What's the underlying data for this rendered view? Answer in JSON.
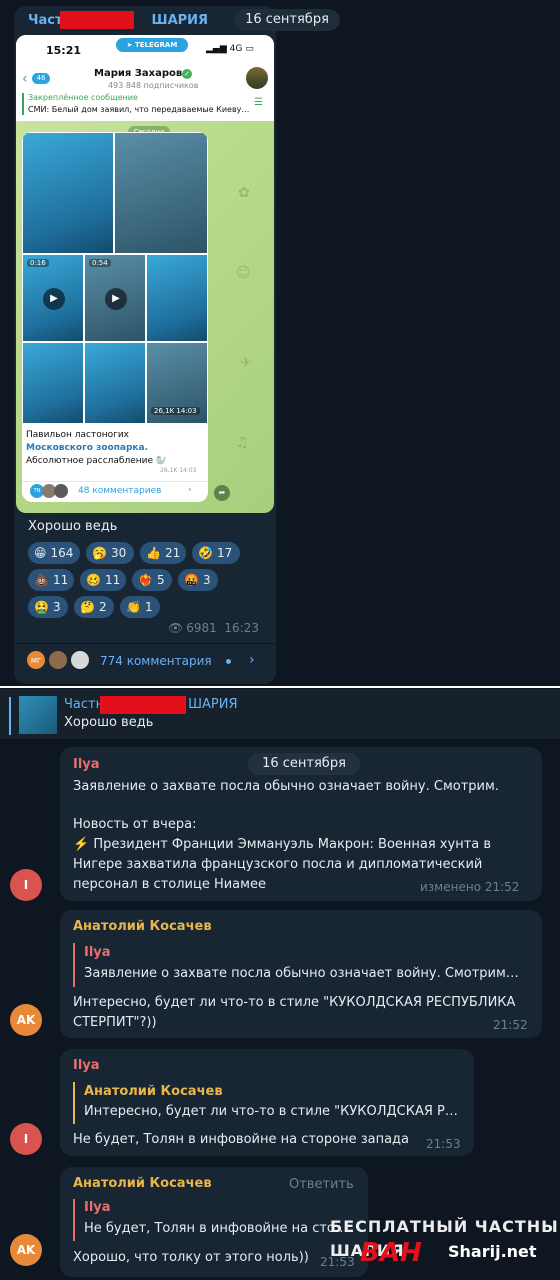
{
  "post": {
    "channel_name_left": "Частн",
    "channel_name_right": "ШАРИЯ",
    "date": "16 сентября",
    "screenshot": {
      "time": "15:21",
      "telegram_label": "TELEGRAM",
      "signal": "4G",
      "back_badge": "46",
      "channel_name": "Мария Захарова",
      "subscribers": "493 848 подписчиков",
      "pinned_title": "Закреплённое сообщение",
      "pinned_text": "СМИ: Белый дом заявил, что передаваемые Киеву…",
      "today": "Сегодня",
      "video1_duration": "0:16",
      "video2_duration": "0:54",
      "photo_views": "26,1K 14:03",
      "caption_line1": "Павильон ластоногих",
      "caption_line2": "Московского зоопарка.",
      "caption_line3": "Абсолютное расслабление 🦭",
      "caption_meta": "26,1K 14:03",
      "comment_avatars": [
        "TN",
        "",
        ""
      ],
      "comments_label": "48 комментариев"
    },
    "text": "Хорошо ведь",
    "reactions": [
      {
        "emoji": "😁",
        "count": "164"
      },
      {
        "emoji": "🥱",
        "count": "30"
      },
      {
        "emoji": "👍",
        "count": "21"
      },
      {
        "emoji": "🤣",
        "count": "17"
      },
      {
        "emoji": "💩",
        "count": "11"
      },
      {
        "emoji": "🥴",
        "count": "11"
      },
      {
        "emoji": "❤‍🔥",
        "count": "5"
      },
      {
        "emoji": "🤬",
        "count": "3"
      },
      {
        "emoji": "🤮",
        "count": "3"
      },
      {
        "emoji": "🤔",
        "count": "2"
      },
      {
        "emoji": "👏",
        "count": "1"
      }
    ],
    "views": "6981",
    "time": "16:23",
    "comment_avatars": [
      "МГ",
      "",
      ""
    ],
    "comments_label": "774 комментария"
  },
  "chat": {
    "reply_header": {
      "title_left": "Частн",
      "title_right": "ШАРИЯ",
      "text": "Хорошо ведь"
    },
    "date_chip": "16 сентября",
    "messages": [
      {
        "author": "Ilya",
        "avatar": "I",
        "lines": [
          "Заявление о захвате посла обычно означает войну. Смотрим.",
          "",
          "Новость от вчера:",
          "⚡️ Президент Франции Эммануэль Макрон: Военная хунта в",
          "Нигере захватила французского посла и дипломатический",
          "персонал в столице Ниамее"
        ],
        "time": "изменено 21:52"
      },
      {
        "author": "Анатолий Косачев",
        "avatar": "AK",
        "quote_author": "Ilya",
        "quote_text": "Заявление о захвате посла обычно означает войну. Смотрим…",
        "lines": [
          "Интересно, будет ли что-то в стиле \"КУКОЛДСКАЯ РЕСПУБЛИКА",
          "СТЕРПИТ\"?))"
        ],
        "time": "21:52"
      },
      {
        "author": "Ilya",
        "avatar": "I",
        "quote_author": "Анатолий Косачев",
        "quote_text": "Интересно, будет ли что-то в стиле \"КУКОЛДСКАЯ Р…",
        "lines": [
          "Не будет, Толян в инфовойне на стороне запада"
        ],
        "time": "21:53"
      },
      {
        "author": "Анатолий Косачев",
        "avatar": "AK",
        "reply_button": "Ответить",
        "quote_author": "Ilya",
        "quote_text": "Не будет, Толян в инфовойне на сто…",
        "lines": [
          "Хорошо, что толку от этого ноль))"
        ],
        "time": "21:53"
      }
    ]
  },
  "watermark": {
    "line1": "БЕСПЛАТНЫЙ ЧАСТНЫЙ",
    "line2": "ШАРИЯ",
    "logo": "ВАН",
    "site": "Sharij.net"
  },
  "colors": {
    "background": "#0e1621",
    "bubble": "#182533",
    "accent": "#6ab2f2",
    "reaction": "#2b5278",
    "redaction": "#e3101c",
    "ilya_name": "#e96f6f",
    "anatoly_name": "#e8b64a"
  }
}
